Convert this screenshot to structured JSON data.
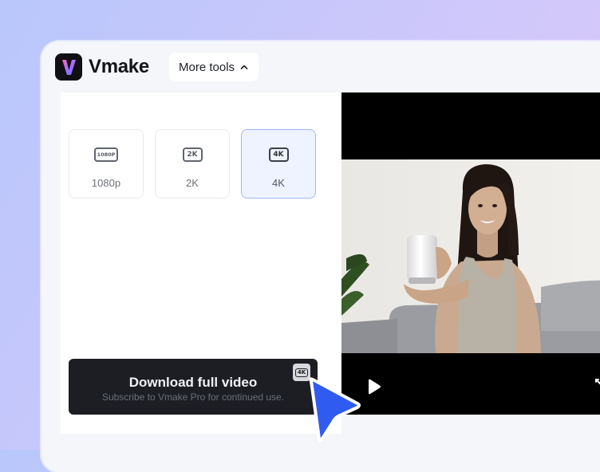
{
  "app": {
    "brand_name": "Vmake",
    "more_tools_label": "More tools"
  },
  "resolution_options": [
    {
      "badge": "1080P",
      "label": "1080p",
      "selected": false
    },
    {
      "badge": "2K",
      "label": "2K",
      "selected": false
    },
    {
      "badge": "4K",
      "label": "4K",
      "selected": true
    }
  ],
  "download": {
    "title": "Download full video",
    "subtitle": "Subscribe to Vmake Pro for continued use.",
    "badge": "4K"
  },
  "icons": {
    "logo": "vmake-logo-icon",
    "more_tools": "chevron-up-icon",
    "play": "play-icon",
    "expand": "expand-icon",
    "cursor": "cursor-arrow-icon"
  },
  "colors": {
    "accent_blue": "#2f5bf0",
    "selected_bg": "#eef3ff",
    "dark_button": "#1c1e24"
  }
}
